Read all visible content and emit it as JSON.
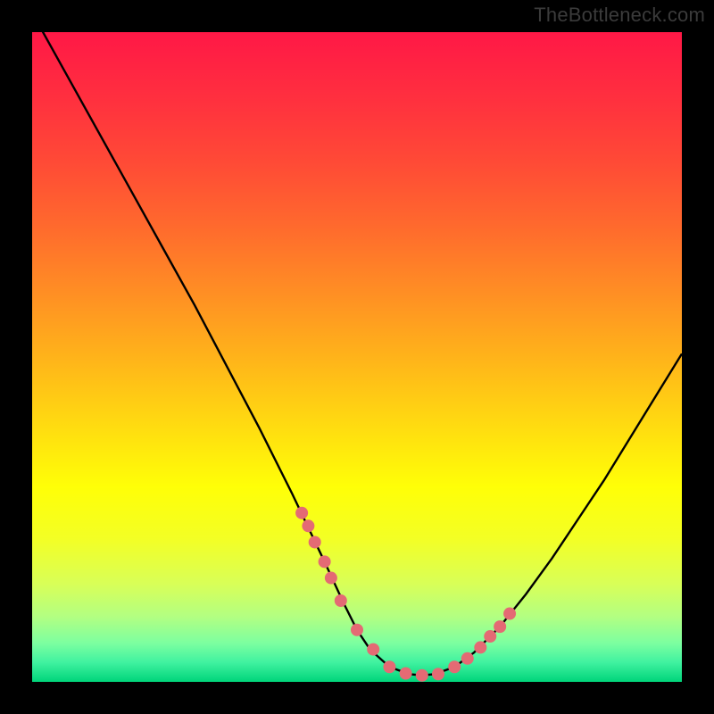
{
  "watermark": "TheBottleneck.com",
  "gradient": {
    "stops": [
      {
        "offset": 0.0,
        "color": "#ff1846"
      },
      {
        "offset": 0.1,
        "color": "#ff2f3f"
      },
      {
        "offset": 0.2,
        "color": "#ff4a36"
      },
      {
        "offset": 0.3,
        "color": "#ff6a2d"
      },
      {
        "offset": 0.4,
        "color": "#ff8e24"
      },
      {
        "offset": 0.5,
        "color": "#ffb31a"
      },
      {
        "offset": 0.6,
        "color": "#ffd911"
      },
      {
        "offset": 0.7,
        "color": "#ffff07"
      },
      {
        "offset": 0.78,
        "color": "#f3ff25"
      },
      {
        "offset": 0.85,
        "color": "#d8ff58"
      },
      {
        "offset": 0.9,
        "color": "#b2ff82"
      },
      {
        "offset": 0.94,
        "color": "#7dffa0"
      },
      {
        "offset": 0.97,
        "color": "#40f2a0"
      },
      {
        "offset": 1.0,
        "color": "#00d47a"
      }
    ]
  },
  "chart_data": {
    "type": "line",
    "title": "",
    "xlabel": "",
    "ylabel": "",
    "xlim": [
      0,
      100
    ],
    "ylim": [
      0,
      100
    ],
    "series": [
      {
        "name": "curve",
        "x": [
          0,
          5,
          10,
          15,
          20,
          25,
          30,
          35,
          40,
          45,
          48,
          50,
          52,
          55,
          58,
          60,
          62,
          65,
          68,
          72,
          76,
          80,
          84,
          88,
          92,
          96,
          100
        ],
        "y": [
          103,
          94,
          85,
          76,
          67,
          58,
          48.5,
          39,
          29,
          18.5,
          12,
          8,
          5,
          2.3,
          1.2,
          1.0,
          1.2,
          2.3,
          4.5,
          8.5,
          13.5,
          19,
          25,
          31,
          37.5,
          44,
          50.5
        ]
      }
    ],
    "markers": {
      "name": "dots",
      "color": "#e46a74",
      "x": [
        41.5,
        42.5,
        43.5,
        45.0,
        46.0,
        47.5,
        50.0,
        52.5,
        55.0,
        57.5,
        60.0,
        62.5,
        65.0,
        67.0,
        69.0,
        70.5,
        72.0,
        73.5
      ],
      "y": [
        26.0,
        24.0,
        21.5,
        18.5,
        16.0,
        12.5,
        8.0,
        5.0,
        2.3,
        1.3,
        1.0,
        1.2,
        2.3,
        3.6,
        5.3,
        7.0,
        8.5,
        10.5
      ]
    }
  }
}
